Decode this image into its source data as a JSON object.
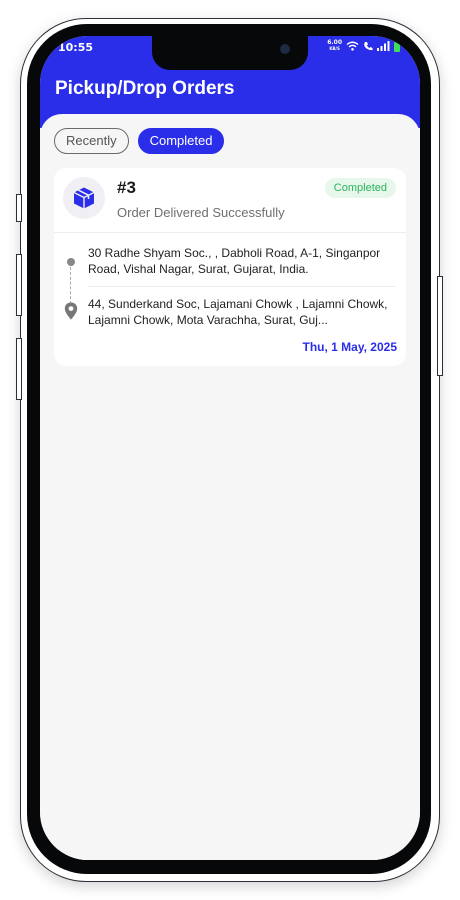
{
  "status_bar": {
    "time": "10:55",
    "net_speed_value": "6.00",
    "net_speed_unit": "KB/S"
  },
  "header": {
    "title": "Pickup/Drop Orders"
  },
  "tabs": [
    {
      "label": "Recently",
      "active": false
    },
    {
      "label": "Completed",
      "active": true
    }
  ],
  "orders": [
    {
      "id": "#3",
      "status_text": "Order Delivered Successfully",
      "badge": "Completed",
      "pickup_address": "30 Radhe Shyam Soc., , Dabholi Road, A-1, Singanpor Road, Vishal Nagar, Surat, Gujarat, India.",
      "drop_address": "44, Sunderkand Soc, Lajamani Chowk , Lajamni Chowk, Lajamni Chowk, Mota Varachha, Surat, Guj...",
      "date": "Thu, 1 May, 2025"
    }
  ],
  "bottom_nav": [
    {
      "icon": "home-icon",
      "active": false
    },
    {
      "icon": "box-icon",
      "active": true
    },
    {
      "icon": "truck-icon",
      "active": false
    },
    {
      "icon": "profile-icon",
      "active": false
    }
  ],
  "colors": {
    "primary": "#2a2ee8",
    "badge_text": "#2cb55a",
    "badge_bg": "#e8f7ec",
    "background": "#f6f6f6"
  }
}
